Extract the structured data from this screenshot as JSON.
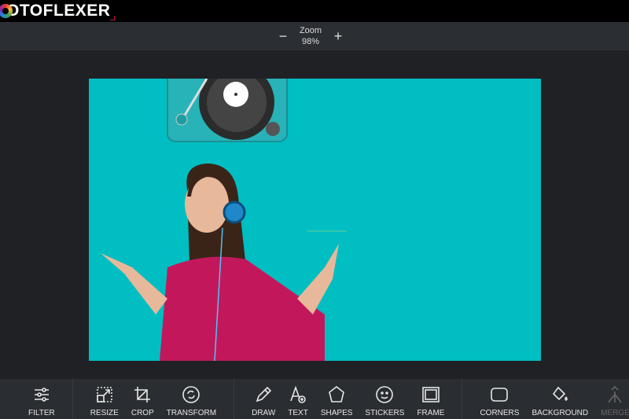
{
  "app": {
    "logo_text": "OTOFLEXER"
  },
  "zoom": {
    "label": "Zoom",
    "value": "98%",
    "minus": "−",
    "plus": "+"
  },
  "canvas": {
    "background_color": "#00bec2"
  },
  "toolbar": {
    "groups": [
      [
        {
          "label": "FILTER",
          "icon": "sliders-icon"
        }
      ],
      [
        {
          "label": "RESIZE",
          "icon": "resize-icon"
        },
        {
          "label": "CROP",
          "icon": "crop-icon"
        },
        {
          "label": "TRANSFORM",
          "icon": "rotate-icon"
        }
      ],
      [
        {
          "label": "DRAW",
          "icon": "pencil-icon"
        },
        {
          "label": "TEXT",
          "icon": "text-add-icon"
        },
        {
          "label": "SHAPES",
          "icon": "pentagon-icon"
        },
        {
          "label": "STICKERS",
          "icon": "smiley-icon"
        },
        {
          "label": "FRAME",
          "icon": "frame-icon"
        }
      ],
      [
        {
          "label": "CORNERS",
          "icon": "rounded-square-icon"
        },
        {
          "label": "BACKGROUND",
          "icon": "paint-bucket-icon"
        },
        {
          "label": "MERGE",
          "icon": "merge-icon",
          "disabled": true
        }
      ]
    ]
  }
}
